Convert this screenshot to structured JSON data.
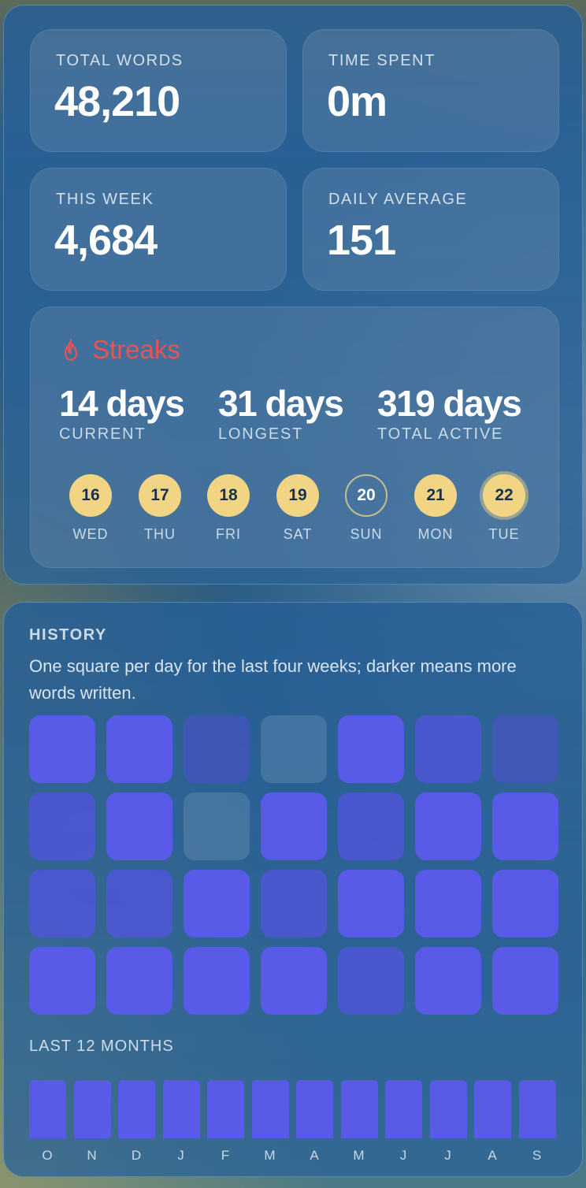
{
  "stats": [
    {
      "label": "TOTAL WORDS",
      "value": "48,210"
    },
    {
      "label": "TIME SPENT",
      "value": "0m"
    },
    {
      "label": "THIS WEEK",
      "value": "4,684"
    },
    {
      "label": "DAILY AVERAGE",
      "value": "151"
    }
  ],
  "streaks": {
    "title": "Streaks",
    "icon": "flame-icon",
    "accent_color": "#e85454",
    "current": {
      "value": "14 days",
      "label": "CURRENT"
    },
    "longest": {
      "value": "31 days",
      "label": "LONGEST"
    },
    "total_active": {
      "value": "319 days",
      "label": "TOTAL ACTIVE"
    },
    "days": [
      {
        "num": "16",
        "name": "WED",
        "active": true
      },
      {
        "num": "17",
        "name": "THU",
        "active": true
      },
      {
        "num": "18",
        "name": "FRI",
        "active": true
      },
      {
        "num": "19",
        "name": "SAT",
        "active": true
      },
      {
        "num": "20",
        "name": "SUN",
        "active": false
      },
      {
        "num": "21",
        "name": "MON",
        "active": true
      },
      {
        "num": "22",
        "name": "TUE",
        "active": true,
        "today": true
      }
    ]
  },
  "history": {
    "title": "HISTORY",
    "description": "One square per day for the last four weeks; darker means more words written.",
    "levels": [
      [
        3,
        3,
        1,
        0,
        3,
        2,
        1
      ],
      [
        2,
        3,
        0,
        3,
        2,
        3,
        3
      ],
      [
        2,
        2,
        3,
        2,
        3,
        3,
        3
      ],
      [
        3,
        3,
        3,
        3,
        2,
        3,
        3
      ]
    ],
    "months_title": "LAST 12 MONTHS",
    "months": [
      "O",
      "N",
      "D",
      "J",
      "F",
      "M",
      "A",
      "M",
      "J",
      "J",
      "A",
      "S"
    ],
    "month_levels": [
      1,
      1,
      1,
      1,
      1,
      1,
      1,
      1,
      1,
      1,
      1,
      1
    ],
    "bar_color": "#5a5ae8"
  }
}
